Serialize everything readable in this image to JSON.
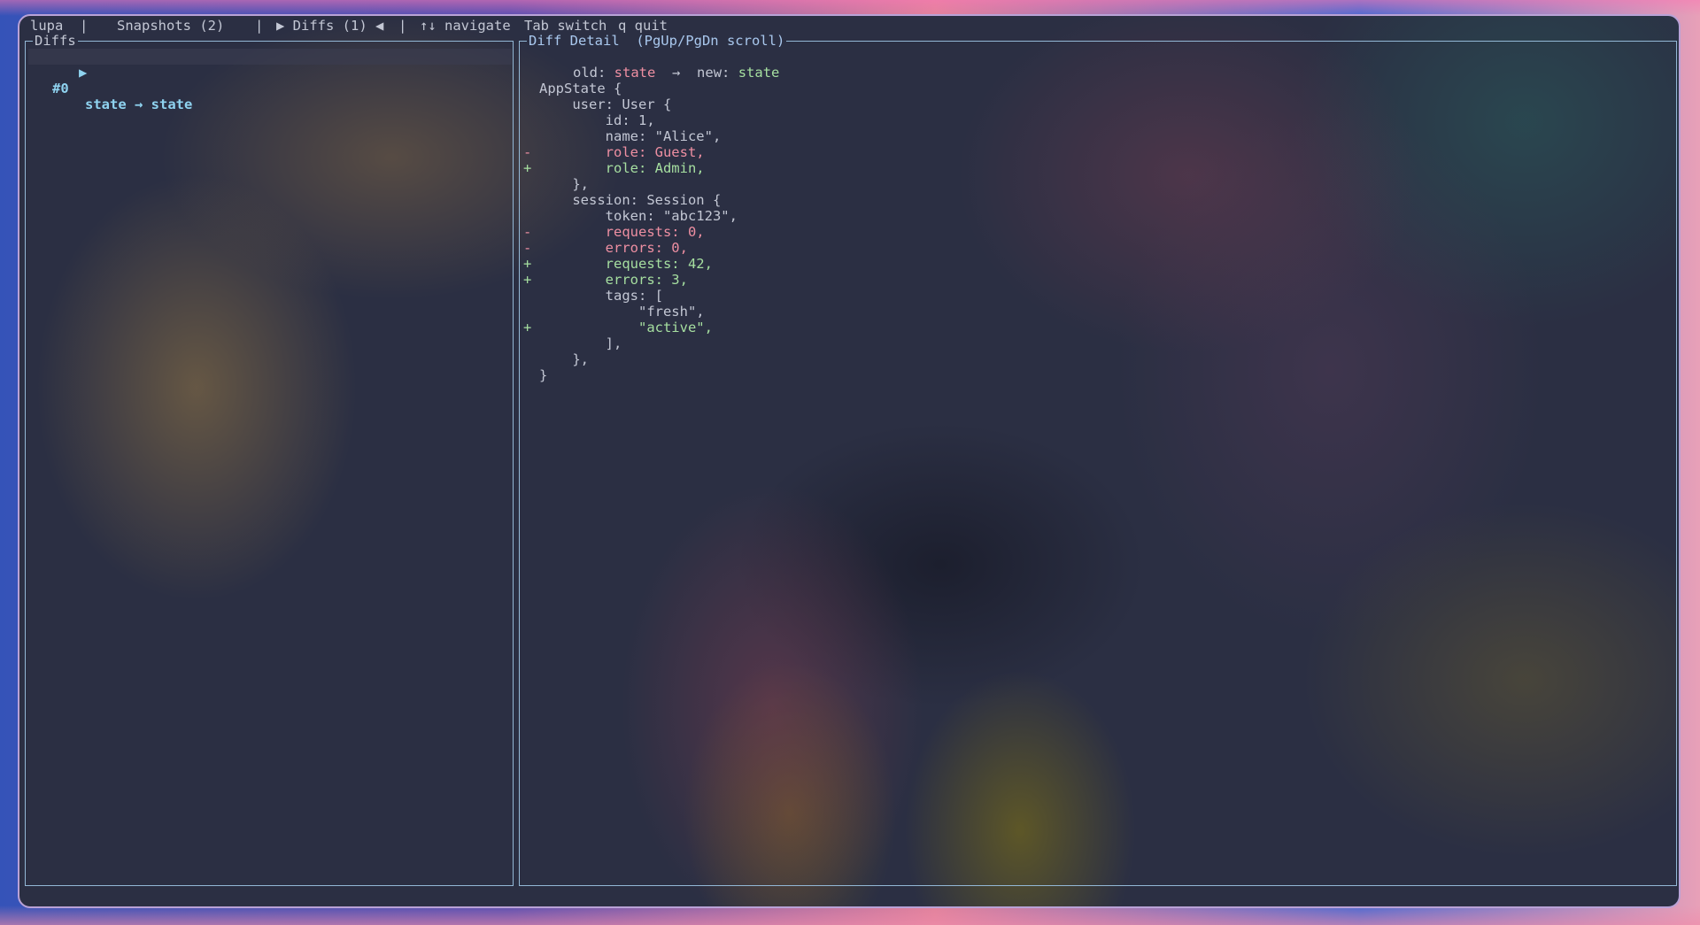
{
  "topbar": {
    "app": "lupa",
    "sep": "|",
    "snapshots_tab": "Snapshots (2)",
    "diffs_tab": "▶ Diffs (1) ◀",
    "hint_navigate": "↑↓ navigate",
    "hint_switch": "Tab switch",
    "hint_quit": "q quit"
  },
  "diffs_panel": {
    "title": "Diffs",
    "items": [
      {
        "marker": "▶",
        "index": "#0",
        "label": "state → state",
        "selected": true
      }
    ]
  },
  "detail_panel": {
    "title": "Diff Detail  (PgUp/PgDn scroll)",
    "old_label": "old:",
    "old_value": "state",
    "arrow": "→",
    "new_label": "new:",
    "new_value": "state",
    "lines": [
      {
        "sign": " ",
        "text": "AppState {",
        "kind": "context"
      },
      {
        "sign": " ",
        "text": "    user: User {",
        "kind": "context"
      },
      {
        "sign": " ",
        "text": "        id: 1,",
        "kind": "context"
      },
      {
        "sign": " ",
        "text": "        name: \"Alice\",",
        "kind": "context"
      },
      {
        "sign": "-",
        "text": "        role: Guest,",
        "kind": "removed"
      },
      {
        "sign": "+",
        "text": "        role: Admin,",
        "kind": "added"
      },
      {
        "sign": " ",
        "text": "    },",
        "kind": "context"
      },
      {
        "sign": " ",
        "text": "    session: Session {",
        "kind": "context"
      },
      {
        "sign": " ",
        "text": "        token: \"abc123\",",
        "kind": "context"
      },
      {
        "sign": "-",
        "text": "        requests: 0,",
        "kind": "removed"
      },
      {
        "sign": "-",
        "text": "        errors: 0,",
        "kind": "removed"
      },
      {
        "sign": "+",
        "text": "        requests: 42,",
        "kind": "added"
      },
      {
        "sign": "+",
        "text": "        errors: 3,",
        "kind": "added"
      },
      {
        "sign": " ",
        "text": "        tags: [",
        "kind": "context"
      },
      {
        "sign": " ",
        "text": "            \"fresh\",",
        "kind": "context"
      },
      {
        "sign": "+",
        "text": "            \"active\",",
        "kind": "added"
      },
      {
        "sign": " ",
        "text": "        ],",
        "kind": "context"
      },
      {
        "sign": " ",
        "text": "    },",
        "kind": "context"
      },
      {
        "sign": " ",
        "text": "}",
        "kind": "context"
      }
    ]
  },
  "colors": {
    "border": "#93b8d6",
    "removed": "#ee8fa2",
    "added": "#a6dfa0",
    "selected": "#8fd3f0",
    "text": "#c3c7d4"
  }
}
